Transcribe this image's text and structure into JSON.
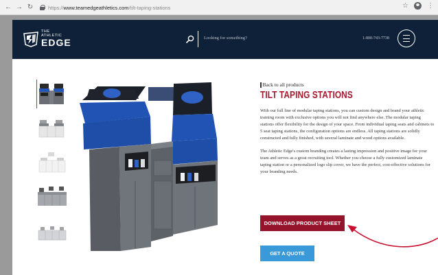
{
  "browser": {
    "url_prefix": "https://",
    "url_host": "www.teamedgeathletics.com",
    "url_path": "/tilt-taping-stations",
    "back_icon": "arrow-left-icon",
    "forward_icon": "arrow-right-icon",
    "reload_icon": "reload-icon",
    "lock_icon": "lock-icon",
    "bookmark_icon": "star-icon",
    "profile_icon": "profile-icon",
    "menu_icon": "kebab-icon"
  },
  "header": {
    "logo_the": "THE",
    "logo_athletic": "ATHLETIC",
    "logo_edge": "EDGE",
    "search_placeholder": "Looking for something?",
    "phone": "1-800-743-7738",
    "menu_icon": "hamburger-icon",
    "background": "#0f2138"
  },
  "gallery": {
    "thumbnails": [
      "taping station thumbnail 1",
      "taping station thumbnail 2",
      "taping station thumbnail 3",
      "taping station thumbnail 4",
      "taping station thumbnail 5"
    ],
    "selected": 0
  },
  "product": {
    "back_link": "Back to all products",
    "title": "TILT TAPING STATIONS",
    "description_1": "With our full line of modular taping stations, you can custom design and brand your athletic training room with exclusive options you will not find anywhere else. The modular taping stations offer flexibility for the design of your space. From individual taping seats and cabinets to 5 seat taping stations, the configuration options are endless. All taping stations are solidly constructed and fully finished, with several laminate and wood options available.",
    "description_2": "The Athletic Edge's custom branding creates a lasting impression and positive image for your team and serves as a great recruiting tool. Whether you choose a fully customized laminate taping station or a personalized logo slip cover, we have the perfect, cost-effective solutions for your branding needs.",
    "download_label": "DOWNLOAD PRODUCT SHEET",
    "quote_label": "GET A QUOTE",
    "title_color": "#a6182d",
    "download_color": "#95142b",
    "quote_color": "#3a9ad9",
    "annotation_color": "#c8102e"
  }
}
